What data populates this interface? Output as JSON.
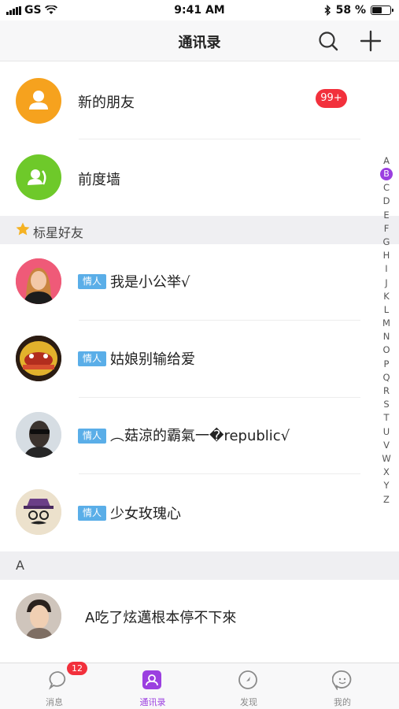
{
  "status_bar": {
    "carrier": "GS",
    "time": "9:41 AM",
    "battery": "58 %",
    "battery_level": 0.58
  },
  "nav": {
    "title": "通讯录"
  },
  "entries": [
    {
      "label": "新的朋友",
      "badge": "99+"
    },
    {
      "label": "前度墙"
    }
  ],
  "starred": {
    "header": "标星好友",
    "contacts": [
      {
        "tag": "情人",
        "name": "我是小公举√"
      },
      {
        "tag": "情人",
        "name": "姑娘别输给爱"
      },
      {
        "tag": "情人",
        "name": "︵菇涼的霸氣一�republic√"
      },
      {
        "tag": "情人",
        "name": "少女玫瑰心"
      }
    ]
  },
  "section_a": {
    "header": "A",
    "contacts": [
      {
        "name": "A吃了炫邁根本停不下來"
      }
    ]
  },
  "index": {
    "letters": [
      "A",
      "B",
      "C",
      "D",
      "E",
      "F",
      "G",
      "H",
      "I",
      "J",
      "K",
      "L",
      "M",
      "N",
      "O",
      "P",
      "Q",
      "R",
      "S",
      "T",
      "U",
      "V",
      "W",
      "X",
      "Y",
      "Z"
    ],
    "active": "B"
  },
  "tabs": [
    {
      "label": "消息",
      "badge": "12",
      "icon": "chat-bubble-icon"
    },
    {
      "label": "通讯录",
      "icon": "contacts-icon",
      "active": true
    },
    {
      "label": "发现",
      "icon": "compass-icon"
    },
    {
      "label": "我的",
      "icon": "profile-face-icon"
    }
  ],
  "colors": {
    "accent": "#9b3fe0",
    "badge_red": "#f2303c",
    "tag_blue": "#5aaee8",
    "new_friend_orange": "#f6a21e",
    "ex_wall_green": "#6ec92a"
  }
}
